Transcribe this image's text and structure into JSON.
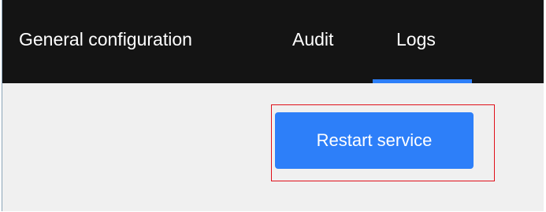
{
  "tabs": [
    {
      "label": "General configuration",
      "active": false
    },
    {
      "label": "Audit",
      "active": false
    },
    {
      "label": "Logs",
      "active": true
    }
  ],
  "main": {
    "restart_button_label": "Restart service"
  },
  "colors": {
    "tabbar_background": "#141414",
    "accent": "#2d7ff9",
    "content_background": "#f0f0f0",
    "highlight_outline": "#e0101a"
  }
}
